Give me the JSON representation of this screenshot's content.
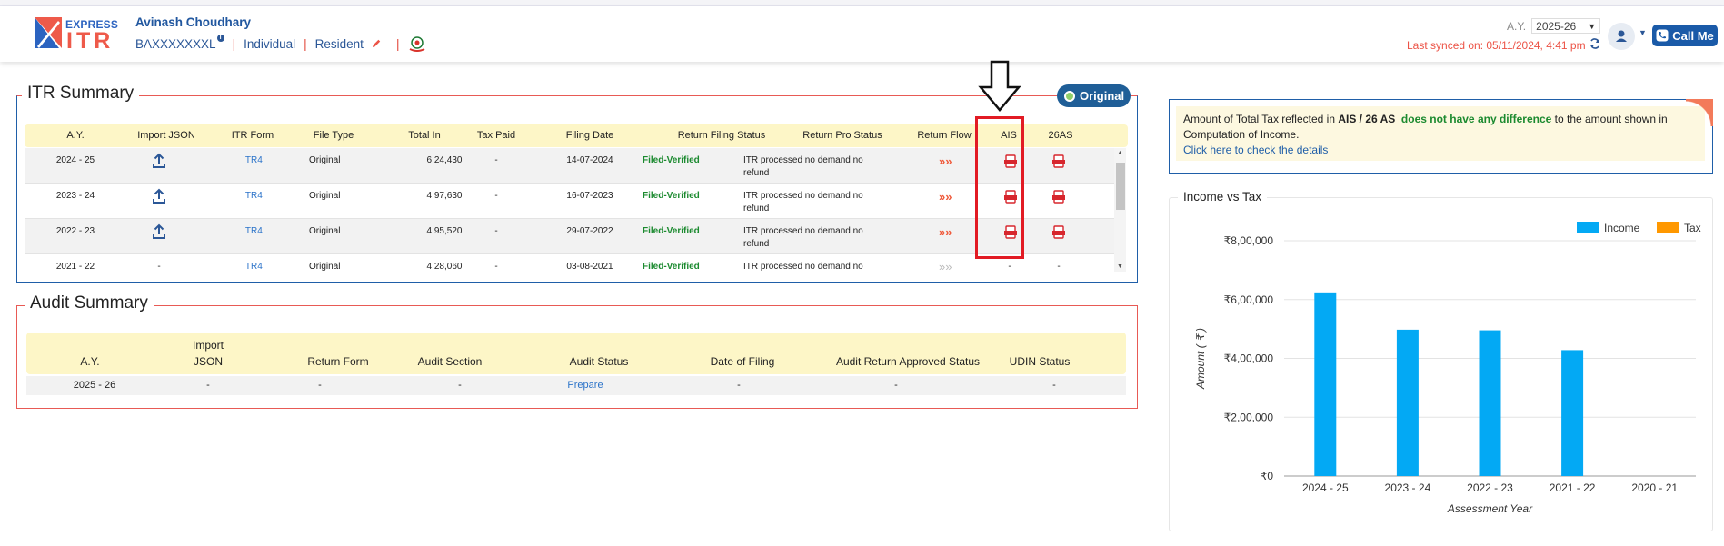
{
  "header": {
    "logo_top": "EXPRESS",
    "logo_main": "ITR",
    "user_name": "Avinash Choudhary",
    "pan": "BAXXXXXXXL",
    "taxpayer_type": "Individual",
    "residency": "Resident",
    "ay_label": "A.Y.",
    "ay_value": "2025-26",
    "last_synced": "Last synced on: 05/11/2024, 4:41 pm",
    "call_label": "Call Me"
  },
  "itr_summary": {
    "title": "ITR Summary",
    "badge": "Original",
    "columns": [
      "A.Y.",
      "Import JSON",
      "ITR Form",
      "File Type",
      "Total In",
      "Tax Paid",
      "Filing Date",
      "Return Filing Status",
      "Return Pro Status",
      "Return Flow",
      "AIS",
      "26AS"
    ],
    "rows": [
      {
        "ay": "2024 - 25",
        "import": "upload-icon",
        "form": "ITR4",
        "type": "Original",
        "total": "6,24,430",
        "tax": "-",
        "date": "14-07-2024",
        "status": "Filed-Verified",
        "pro1": "ITR processed no demand no",
        "pro2": "refund",
        "ais": "pdf-icon",
        "as26": "pdf-icon"
      },
      {
        "ay": "2023 - 24",
        "import": "upload-icon",
        "form": "ITR4",
        "type": "Original",
        "total": "4,97,630",
        "tax": "-",
        "date": "16-07-2023",
        "status": "Filed-Verified",
        "pro1": "ITR processed no demand no",
        "pro2": "refund",
        "ais": "pdf-icon",
        "as26": "pdf-icon"
      },
      {
        "ay": "2022 - 23",
        "import": "upload-icon",
        "form": "ITR4",
        "type": "Original",
        "total": "4,95,520",
        "tax": "-",
        "date": "29-07-2022",
        "status": "Filed-Verified",
        "pro1": "ITR processed no demand no",
        "pro2": "refund",
        "ais": "pdf-icon",
        "as26": "pdf-icon"
      },
      {
        "ay": "2021 - 22",
        "import": "-",
        "form": "ITR4",
        "type": "Original",
        "total": "4,28,060",
        "tax": "-",
        "date": "03-08-2021",
        "status": "Filed-Verified",
        "pro1": "ITR processed no demand no",
        "pro2": "refund",
        "ais": "-",
        "as26": "-"
      }
    ]
  },
  "audit_summary": {
    "title": "Audit Summary",
    "columns": [
      "A.Y.",
      "Import",
      "JSON",
      "Return Form",
      "Audit Section",
      "Audit Status",
      "Date of Filing",
      "Audit Return Approved Status",
      "UDIN Status"
    ],
    "row": {
      "ay": "2025 - 26",
      "import": "-",
      "form": "-",
      "section": "-",
      "status": "Prepare",
      "date": "-",
      "approved": "-",
      "udin": "-"
    }
  },
  "notice": {
    "p1": "Amount of Total Tax reflected in ",
    "p2": "AIS / 26 AS",
    "p3": "does not have any difference",
    "p4": " to the amount shown in",
    "p5": "Computation of Income.",
    "link": "Click here to check the details"
  },
  "chart_data": {
    "type": "bar",
    "title": "Income vs Tax",
    "categories": [
      "2024 - 25",
      "2023 - 24",
      "2022 - 23",
      "2021 - 22",
      "2020 - 21"
    ],
    "series": [
      {
        "name": "Income",
        "color": "#03a9f4",
        "values": [
          624430,
          497630,
          495520,
          428060,
          0
        ]
      },
      {
        "name": "Tax",
        "color": "#ff9800",
        "values": [
          0,
          0,
          0,
          0,
          0
        ]
      }
    ],
    "xlabel": "Assessment Year",
    "ylabel": "Amount ( ₹ )",
    "yticks": [
      "₹0",
      "₹2,00,000",
      "₹4,00,000",
      "₹6,00,000",
      "₹8,00,000"
    ],
    "ylim": [
      0,
      800000
    ],
    "legend": "top-right",
    "grid": true
  },
  "colors": {
    "brand_blue": "#1f5ea8",
    "accent_red": "#e85a55",
    "header_yellow": "#fdf6c7",
    "status_green": "#1b8a2f"
  }
}
